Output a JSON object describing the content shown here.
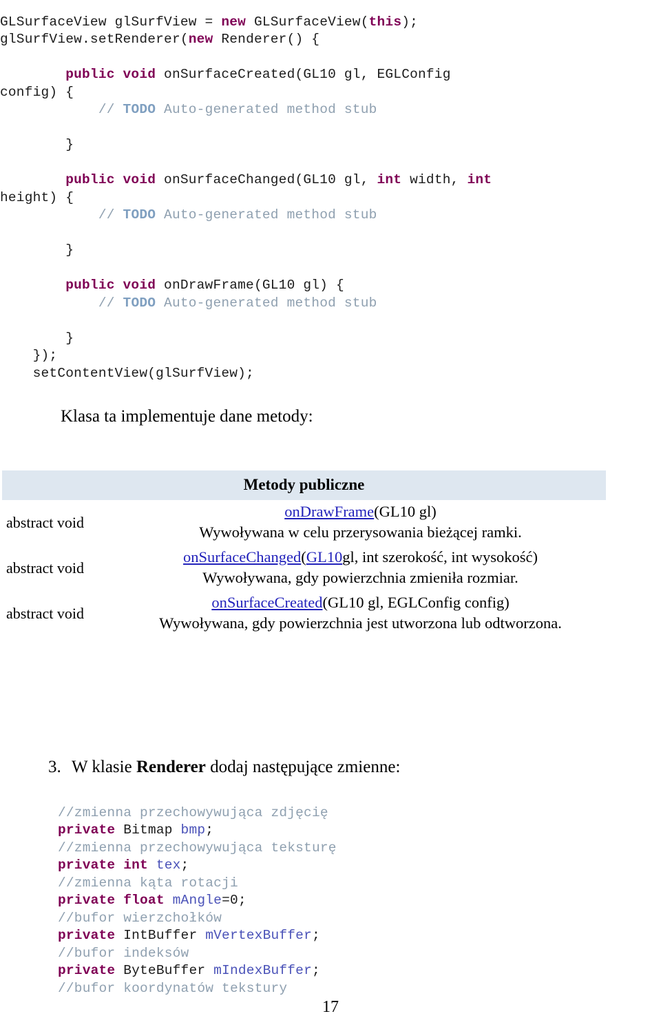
{
  "page": {
    "number": "17",
    "language": "pl"
  },
  "colors": {
    "keyword": "#7f0055",
    "comment": "#8fa0b0",
    "comment_todo": "#7f9fc0",
    "variable": "#4a52b8",
    "link": "#2222bb",
    "table_header_bg": "#dee7f0",
    "text": "#000000"
  },
  "code_top": {
    "lines": [
      {
        "indent": 0,
        "tokens": [
          {
            "t": "GLSurfaceView glSurfView = ",
            "c": "plain"
          },
          {
            "t": "new",
            "c": "kw"
          },
          {
            "t": " GLSurfaceView(",
            "c": "plain"
          },
          {
            "t": "this",
            "c": "kw"
          },
          {
            "t": ");",
            "c": "plain"
          }
        ]
      },
      {
        "indent": 0,
        "tokens": [
          {
            "t": "glSurfView.setRenderer(",
            "c": "plain"
          },
          {
            "t": "new",
            "c": "kw"
          },
          {
            "t": " Renderer() {",
            "c": "plain"
          }
        ]
      },
      {
        "indent": 0,
        "tokens": [
          {
            "t": "",
            "c": "plain"
          }
        ]
      },
      {
        "indent": 0,
        "tokens": [
          {
            "t": "        ",
            "c": "plain"
          },
          {
            "t": "public void",
            "c": "kw"
          },
          {
            "t": " onSurfaceCreated(GL10 gl, EGLConfig",
            "c": "plain"
          }
        ]
      },
      {
        "indent": 0,
        "tokens": [
          {
            "t": "config) {",
            "c": "plain"
          }
        ]
      },
      {
        "indent": 0,
        "tokens": [
          {
            "t": "            ",
            "c": "plain"
          },
          {
            "t": "// ",
            "c": "cmt"
          },
          {
            "t": "TODO",
            "c": "todo"
          },
          {
            "t": " Auto-generated method stub",
            "c": "cmt"
          }
        ]
      },
      {
        "indent": 0,
        "tokens": [
          {
            "t": "",
            "c": "plain"
          }
        ]
      },
      {
        "indent": 0,
        "tokens": [
          {
            "t": "        }",
            "c": "plain"
          }
        ]
      },
      {
        "indent": 0,
        "tokens": [
          {
            "t": "",
            "c": "plain"
          }
        ]
      },
      {
        "indent": 0,
        "tokens": [
          {
            "t": "        ",
            "c": "plain"
          },
          {
            "t": "public void",
            "c": "kw"
          },
          {
            "t": " onSurfaceChanged(GL10 gl, ",
            "c": "plain"
          },
          {
            "t": "int",
            "c": "kw"
          },
          {
            "t": " width, ",
            "c": "plain"
          },
          {
            "t": "int",
            "c": "kw"
          }
        ]
      },
      {
        "indent": 0,
        "tokens": [
          {
            "t": "height) {",
            "c": "plain"
          }
        ]
      },
      {
        "indent": 0,
        "tokens": [
          {
            "t": "            ",
            "c": "plain"
          },
          {
            "t": "// ",
            "c": "cmt"
          },
          {
            "t": "TODO",
            "c": "todo"
          },
          {
            "t": " Auto-generated method stub",
            "c": "cmt"
          }
        ]
      },
      {
        "indent": 0,
        "tokens": [
          {
            "t": "",
            "c": "plain"
          }
        ]
      },
      {
        "indent": 0,
        "tokens": [
          {
            "t": "        }",
            "c": "plain"
          }
        ]
      },
      {
        "indent": 0,
        "tokens": [
          {
            "t": "",
            "c": "plain"
          }
        ]
      },
      {
        "indent": 0,
        "tokens": [
          {
            "t": "        ",
            "c": "plain"
          },
          {
            "t": "public void",
            "c": "kw"
          },
          {
            "t": " onDrawFrame(GL10 gl) {",
            "c": "plain"
          }
        ]
      },
      {
        "indent": 0,
        "tokens": [
          {
            "t": "            ",
            "c": "plain"
          },
          {
            "t": "// ",
            "c": "cmt"
          },
          {
            "t": "TODO",
            "c": "todo"
          },
          {
            "t": " Auto-generated method stub",
            "c": "cmt"
          }
        ]
      },
      {
        "indent": 0,
        "tokens": [
          {
            "t": "",
            "c": "plain"
          }
        ]
      },
      {
        "indent": 0,
        "tokens": [
          {
            "t": "        }",
            "c": "plain"
          }
        ]
      },
      {
        "indent": 0,
        "tokens": [
          {
            "t": "    });",
            "c": "plain"
          }
        ]
      },
      {
        "indent": 0,
        "tokens": [
          {
            "t": "    setContentView(glSurfView);",
            "c": "plain"
          }
        ]
      }
    ]
  },
  "klasa_line": "Klasa ta implementuje dane metody:",
  "methods_table": {
    "header": "Metody publiczne",
    "rows": [
      {
        "modifier": "abstract void",
        "signature_parts": [
          {
            "t": "onDrawFrame",
            "link": true
          },
          {
            "t": "(GL10 gl)",
            "link": false
          }
        ],
        "description": "Wywoływana w celu przerysowania bieżącej ramki."
      },
      {
        "modifier": "abstract void",
        "signature_parts": [
          {
            "t": "onSurfaceChanged",
            "link": true
          },
          {
            "t": "(",
            "link": false
          },
          {
            "t": "GL10",
            "link": true
          },
          {
            "t": "gl, int szerokość, int wysokość)",
            "link": false
          }
        ],
        "description": "Wywoływana, gdy powierzchnia zmieniła rozmiar."
      },
      {
        "modifier": "abstract void",
        "signature_parts": [
          {
            "t": "onSurfaceCreated",
            "link": true
          },
          {
            "t": "(GL10 gl, EGLConfig config)",
            "link": false
          }
        ],
        "description": "Wywoływana, gdy powierzchnia jest utworzona lub odtworzona."
      }
    ]
  },
  "step_3": {
    "number": "3.",
    "prefix": "W klasie ",
    "strong": "Renderer",
    "suffix": " dodaj następujące zmienne:"
  },
  "code_bottom": {
    "lines": [
      {
        "tokens": [
          {
            "t": "//zmienna przechowywująca zdjęcię",
            "c": "cmt"
          }
        ]
      },
      {
        "tokens": [
          {
            "t": "private",
            "c": "kw"
          },
          {
            "t": " Bitmap ",
            "c": "plain"
          },
          {
            "t": "bmp",
            "c": "var"
          },
          {
            "t": ";",
            "c": "plain"
          }
        ]
      },
      {
        "tokens": [
          {
            "t": "//zmienna przechowywująca teksturę",
            "c": "cmt"
          }
        ]
      },
      {
        "tokens": [
          {
            "t": "private int",
            "c": "kw"
          },
          {
            "t": " ",
            "c": "plain"
          },
          {
            "t": "tex",
            "c": "var"
          },
          {
            "t": ";",
            "c": "plain"
          }
        ]
      },
      {
        "tokens": [
          {
            "t": "//zmienna kąta rotacji",
            "c": "cmt"
          }
        ]
      },
      {
        "tokens": [
          {
            "t": "private float",
            "c": "kw"
          },
          {
            "t": " ",
            "c": "plain"
          },
          {
            "t": "mAngle",
            "c": "var"
          },
          {
            "t": "=0;",
            "c": "plain"
          }
        ]
      },
      {
        "tokens": [
          {
            "t": "//bufor wierzchołków",
            "c": "cmt"
          }
        ]
      },
      {
        "tokens": [
          {
            "t": "private",
            "c": "kw"
          },
          {
            "t": " IntBuffer ",
            "c": "plain"
          },
          {
            "t": "mVertexBuffer",
            "c": "var"
          },
          {
            "t": ";",
            "c": "plain"
          }
        ]
      },
      {
        "tokens": [
          {
            "t": "//bufor indeksów",
            "c": "cmt"
          }
        ]
      },
      {
        "tokens": [
          {
            "t": "private",
            "c": "kw"
          },
          {
            "t": " ByteBuffer ",
            "c": "plain"
          },
          {
            "t": "mIndexBuffer",
            "c": "var"
          },
          {
            "t": ";",
            "c": "plain"
          }
        ]
      },
      {
        "tokens": [
          {
            "t": "//bufor koordynatów tekstury",
            "c": "cmt"
          }
        ]
      }
    ]
  }
}
